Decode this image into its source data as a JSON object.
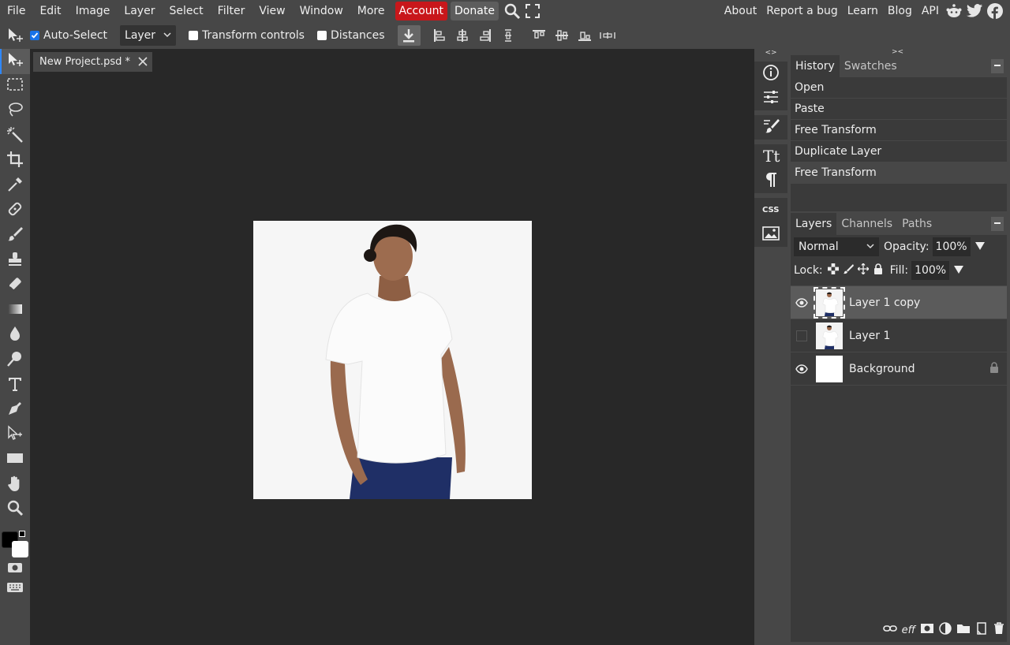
{
  "menu": {
    "items": [
      "File",
      "Edit",
      "Image",
      "Layer",
      "Select",
      "Filter",
      "View",
      "Window",
      "More"
    ],
    "account": "Account",
    "donate": "Donate",
    "right_links": [
      "About",
      "Report a bug",
      "Learn",
      "Blog",
      "API"
    ]
  },
  "options": {
    "auto_select_label": "Auto-Select",
    "auto_select_checked": true,
    "layer_select_value": "Layer",
    "transform_controls_label": "Transform controls",
    "distances_label": "Distances"
  },
  "document": {
    "tab_title": "New Project.psd *"
  },
  "history_panel": {
    "tabs": [
      "History",
      "Swatches"
    ],
    "items": [
      "Open",
      "Paste",
      "Free Transform",
      "Duplicate Layer",
      "Free Transform"
    ],
    "current_index": 4
  },
  "layers_panel": {
    "tabs": [
      "Layers",
      "Channels",
      "Paths"
    ],
    "blend_mode": "Normal",
    "opacity_label": "Opacity:",
    "opacity_value": "100%",
    "lock_label": "Lock:",
    "fill_label": "Fill:",
    "fill_value": "100%",
    "layers": [
      {
        "name": "Layer 1 copy",
        "visible": true,
        "selected": true
      },
      {
        "name": "Layer 1",
        "visible": false,
        "selected": false
      },
      {
        "name": "Background",
        "visible": true,
        "locked": true
      }
    ],
    "bottom_eff_label": "eff"
  },
  "colors": {
    "accent": "#2e88ff",
    "account_red": "#c8171b",
    "canvas_bg": "#282828",
    "panel_bg": "#3a3a3a"
  }
}
